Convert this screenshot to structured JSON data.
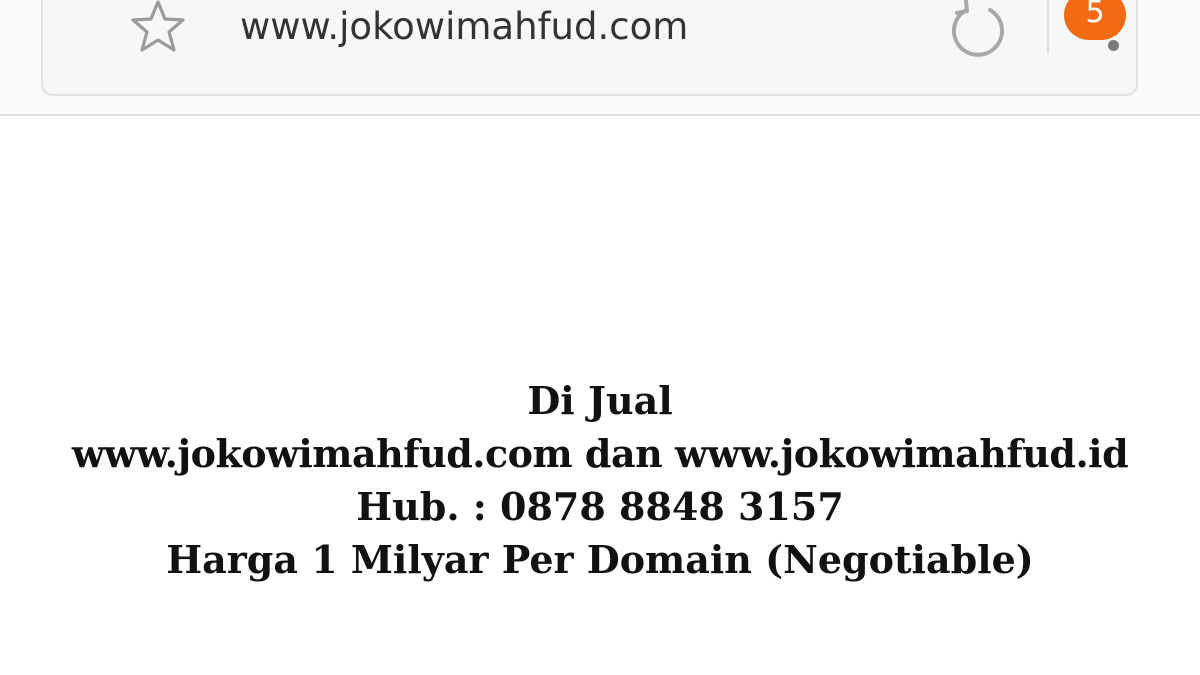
{
  "browser": {
    "address_bar": {
      "url": "www.jokowimahfud.com"
    },
    "bookmark_icon": "star-icon",
    "reload_icon": "reload-icon",
    "menu_icon": "menu-icon",
    "notification_badge": "5",
    "badge_color": "#f26a13"
  },
  "page": {
    "lines": [
      "Di Jual",
      "www.jokowimahfud.com dan www.jokowimahfud.id",
      "Hub. : 0878 8848 3157",
      "Harga 1 Milyar Per Domain (Negotiable)"
    ]
  }
}
